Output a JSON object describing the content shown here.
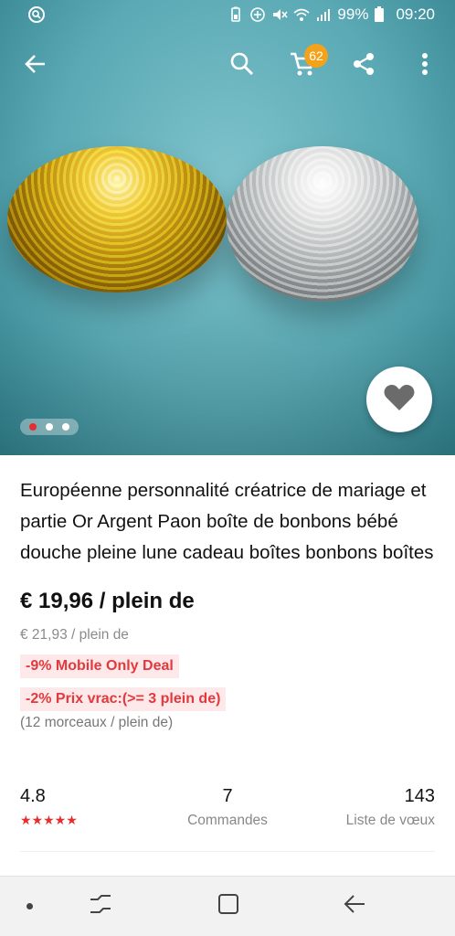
{
  "status_bar": {
    "battery": "99%",
    "time": "09:20"
  },
  "toolbar": {
    "cart_count": "62"
  },
  "gallery": {
    "dots": 3,
    "active_dot": 0
  },
  "product": {
    "title": "Européenne personnalité créatrice de mariage et partie Or Argent Paon boîte de bonbons bébé douche pleine lune cadeau boîtes bonbons boîtes",
    "price": "€ 19,96 / plein de",
    "original_price": "€ 21,93 / plein de",
    "deal_tag": "-9% Mobile Only Deal",
    "bulk_tag": "-2% Prix vrac:(>= 3 plein de)",
    "pieces": "(12 morceaux / plein de)"
  },
  "stats": {
    "rating": "4.8",
    "stars": "★★★★★",
    "orders": "7",
    "orders_label": "Commandes",
    "wishlist": "143",
    "wishlist_label": "Liste de vœux"
  },
  "colors": {
    "accent_red": "#e3393c",
    "badge_orange": "#f4a21a",
    "hero_teal": "#5aa9b4"
  },
  "icons": [
    "search-icon",
    "cart-icon",
    "share-icon",
    "more-vert-icon",
    "back-arrow-icon",
    "heart-icon",
    "recent-apps-icon",
    "home-icon",
    "nav-back-icon"
  ]
}
